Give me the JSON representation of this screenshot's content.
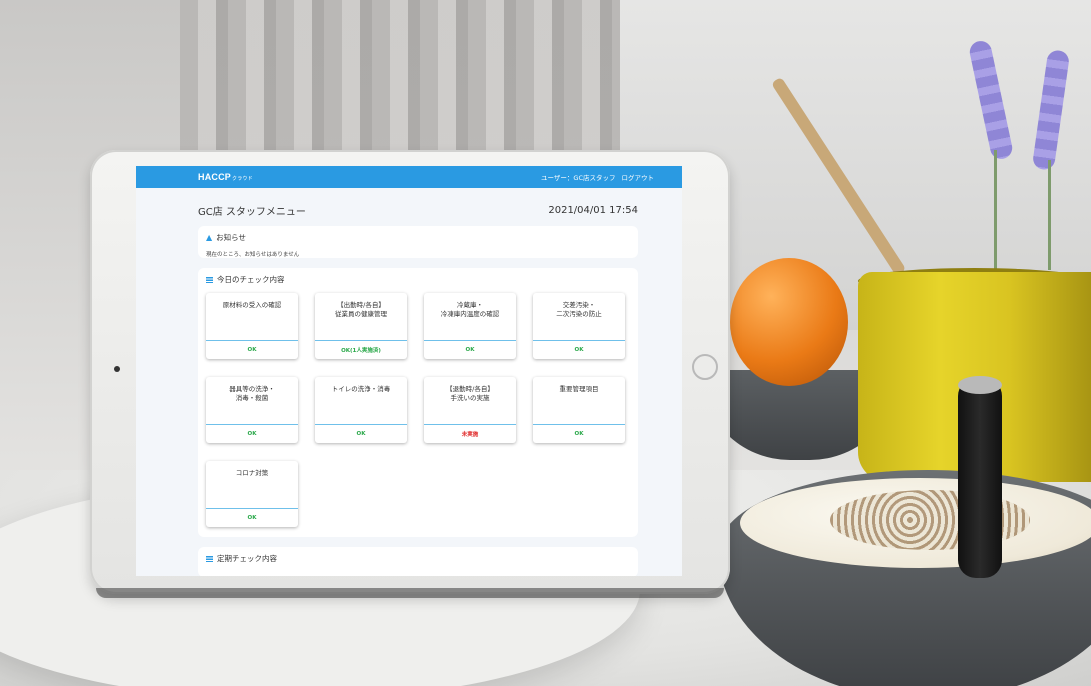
{
  "app": {
    "logo_main": "HACCP",
    "logo_sub": "クラウド",
    "user_label": "ユーザー：GC店スタッフ",
    "logout_label": "ログアウト",
    "accent_color": "#2a9ae2"
  },
  "page": {
    "title": "GC店 スタッフメニュー",
    "datetime": "2021/04/01 17:54"
  },
  "notice": {
    "heading": "お知らせ",
    "icon": "bell-icon",
    "text": "現在のところ、お知らせはありません"
  },
  "today": {
    "heading": "今日のチェック内容",
    "icon": "list-icon",
    "cards": [
      {
        "label": "原材料の受入の確認",
        "status": "OK",
        "status_type": "ok"
      },
      {
        "label": "【出勤時/各自】\n従業員の健康管理",
        "status": "OK(1人実施済)",
        "status_type": "ok"
      },
      {
        "label": "冷蔵庫・\n冷凍庫内温度の確認",
        "status": "OK",
        "status_type": "ok"
      },
      {
        "label": "交差汚染・\n二次汚染の防止",
        "status": "OK",
        "status_type": "ok"
      },
      {
        "label": "器具等の洗浄・\n消毒・殺菌",
        "status": "OK",
        "status_type": "ok"
      },
      {
        "label": "トイレの洗浄・消毒",
        "status": "OK",
        "status_type": "ok"
      },
      {
        "label": "【退勤時/各自】\n手洗いの実施",
        "status": "未実施",
        "status_type": "ng"
      },
      {
        "label": "重要管理項目",
        "status": "OK",
        "status_type": "ok"
      },
      {
        "label": "コロナ対策",
        "status": "OK",
        "status_type": "ok"
      }
    ]
  },
  "periodic": {
    "heading": "定期チェック内容",
    "icon": "list-icon"
  }
}
